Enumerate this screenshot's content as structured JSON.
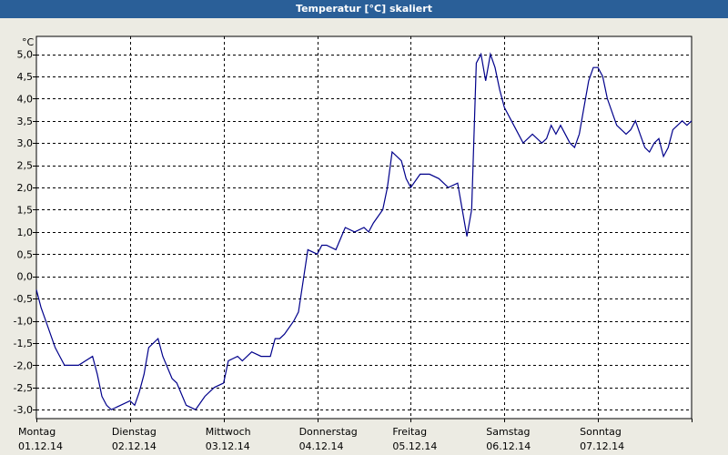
{
  "window": {
    "title": "Temperatur [°C] skaliert"
  },
  "chart_data": {
    "type": "line",
    "title": "Temperatur [°C] skaliert",
    "ylabel": "°C",
    "xlabel": "",
    "ylim": [
      -3.2,
      5.4
    ],
    "yticks": [
      "5,0",
      "4,5",
      "4,0",
      "3,5",
      "3,0",
      "2,5",
      "2,0",
      "1,5",
      "1,0",
      "0,5",
      "0,0",
      "-0,5",
      "-1,0",
      "-1,5",
      "-2,0",
      "-2,5",
      "-3,0"
    ],
    "ytick_values": [
      5.0,
      4.5,
      4.0,
      3.5,
      3.0,
      2.5,
      2.0,
      1.5,
      1.0,
      0.5,
      0.0,
      -0.5,
      -1.0,
      -1.5,
      -2.0,
      -2.5,
      -3.0
    ],
    "days": [
      {
        "weekday": "Montag",
        "date": "01.12.14"
      },
      {
        "weekday": "Dienstag",
        "date": "02.12.14"
      },
      {
        "weekday": "Mittwoch",
        "date": "03.12.14"
      },
      {
        "weekday": "Donnerstag",
        "date": "04.12.14"
      },
      {
        "weekday": "Freitag",
        "date": "05.12.14"
      },
      {
        "weekday": "Samstag",
        "date": "06.12.14"
      },
      {
        "weekday": "Sonntag",
        "date": "07.12.14"
      }
    ],
    "grid": true,
    "line_color": "#00008b",
    "series": [
      {
        "x": [
          0,
          0.05,
          0.1,
          0.2,
          0.25,
          0.3,
          0.45,
          0.6,
          0.65,
          0.7,
          0.75,
          0.8,
          0.9,
          1.0,
          1.05,
          1.1,
          1.15,
          1.2,
          1.3,
          1.35,
          1.45,
          1.5,
          1.6,
          1.7,
          1.8,
          1.9,
          2.0,
          2.05,
          2.15,
          2.2,
          2.3,
          2.4,
          2.5,
          2.55,
          2.6,
          2.65,
          2.75,
          2.8,
          2.9,
          3.0,
          3.05,
          3.1,
          3.2,
          3.3,
          3.4,
          3.5,
          3.55,
          3.6,
          3.7,
          3.75,
          3.8,
          3.9,
          3.95,
          4.0,
          4.1,
          4.2,
          4.3,
          4.4,
          4.5,
          4.55,
          4.6,
          4.65,
          4.7,
          4.75,
          4.8,
          4.85,
          4.9,
          4.95,
          5.0,
          5.1,
          5.2,
          5.3,
          5.4,
          5.45,
          5.5,
          5.55,
          5.6,
          5.7,
          5.75,
          5.8,
          5.85,
          5.9,
          5.95,
          6.0,
          6.05,
          6.1,
          6.2,
          6.3,
          6.35,
          6.4,
          6.45,
          6.5,
          6.55,
          6.6,
          6.65,
          6.7,
          6.75,
          6.8,
          6.9,
          6.95,
          7.0
        ],
        "y": [
          -0.3,
          -0.7,
          -1.0,
          -1.6,
          -1.8,
          -2.0,
          -2.0,
          -1.8,
          -2.2,
          -2.7,
          -2.9,
          -3.0,
          -2.9,
          -2.8,
          -2.9,
          -2.6,
          -2.2,
          -1.6,
          -1.4,
          -1.8,
          -2.3,
          -2.4,
          -2.9,
          -3.0,
          -2.7,
          -2.5,
          -2.4,
          -1.9,
          -1.8,
          -1.9,
          -1.7,
          -1.8,
          -1.8,
          -1.4,
          -1.4,
          -1.3,
          -1.0,
          -0.8,
          0.6,
          0.5,
          0.7,
          0.7,
          0.6,
          1.1,
          1.0,
          1.1,
          1.0,
          1.2,
          1.5,
          2.0,
          2.8,
          2.6,
          2.2,
          2.0,
          2.3,
          2.3,
          2.2,
          2.0,
          2.1,
          1.5,
          0.9,
          1.5,
          4.8,
          5.0,
          4.4,
          5.0,
          4.7,
          4.2,
          3.8,
          3.4,
          3.0,
          3.2,
          3.0,
          3.1,
          3.4,
          3.2,
          3.4,
          3.0,
          2.9,
          3.2,
          3.8,
          4.4,
          4.7,
          4.7,
          4.5,
          4.0,
          3.4,
          3.2,
          3.3,
          3.5,
          3.2,
          2.9,
          2.8,
          3.0,
          3.1,
          2.7,
          2.9,
          3.3,
          3.5,
          3.4,
          3.5
        ]
      }
    ]
  }
}
